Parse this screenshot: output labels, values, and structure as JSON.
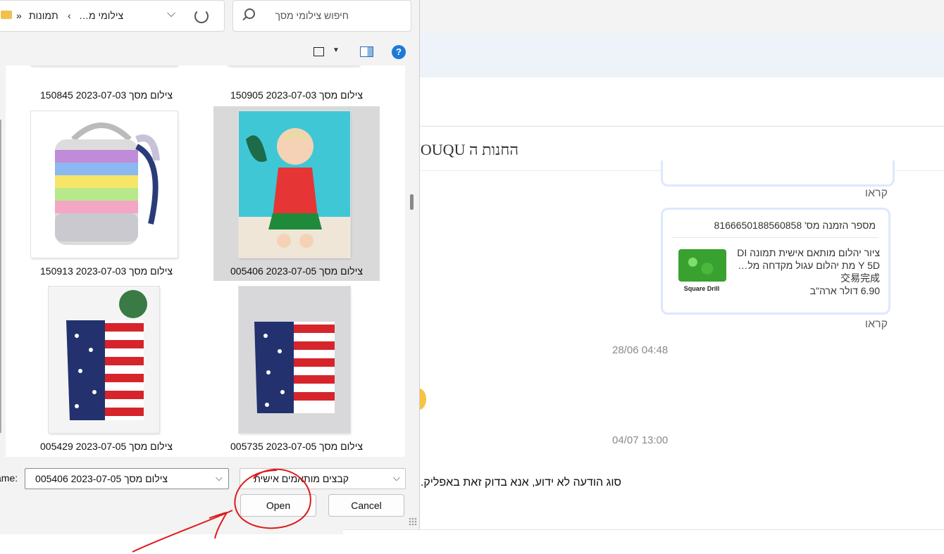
{
  "chat": {
    "title": "YOUQU החנות ה",
    "read_label_1": "קראו",
    "order": {
      "number_label": "מספר הזמנה מס' 8166650188560858",
      "desc_line1": "ציור יהלום מותאם אישית תמונה DI",
      "desc_line2": "Y 5D מת יהלום עגול מקדחה מל…",
      "status": "交易完成",
      "price": "6.90 דולר ארה\"ב",
      "image_label": "Square Drill"
    },
    "read_label_2": "קראו",
    "timestamp_1": "28/06 04:48",
    "timestamp_2": "04/07 13:00",
    "message": "סוג הודעה לא ידוע, אנא בדוק זאת באפליק."
  },
  "dialog": {
    "breadcrumb": [
      "»",
      "תמונות",
      "‹",
      "…צילומי מ"
    ],
    "search_placeholder": "חיפוש צילומי מסך",
    "help_label": "?",
    "files": [
      {
        "caption": "צילום מסך 2023-07-03 150845"
      },
      {
        "caption": "צילום מסך 2023-07-03 150905"
      },
      {
        "caption": "צילום מסך 2023-07-03 150913"
      },
      {
        "caption": "צילום מסך 2023-07-05 005406"
      },
      {
        "caption": "צילום מסך 2023-07-05 005429"
      },
      {
        "caption": "צילום מסך 2023-07-05 005735"
      }
    ],
    "filename_label": "ame:",
    "filename_value": "צילום מסך 2023-07-05 005406",
    "filetype_value": "קבצים מותאמים אישית",
    "open_label": "Open",
    "cancel_label": "Cancel",
    "chevron": "⌵"
  },
  "colors": {
    "accent": "#1f7ad6",
    "annotation": "#e0191b",
    "card_border": "#dce9fb"
  }
}
